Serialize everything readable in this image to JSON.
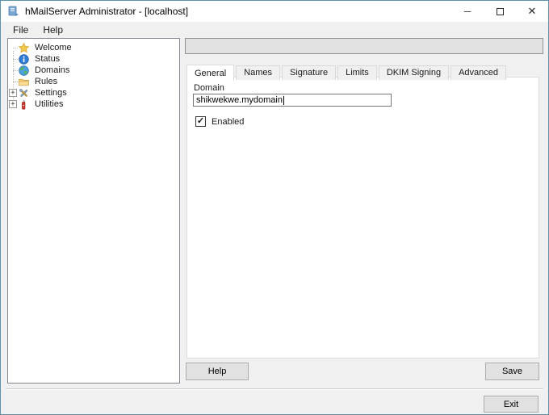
{
  "window": {
    "title": "hMailServer Administrator - [localhost]",
    "minimize_glyph": "─",
    "close_glyph": "✕"
  },
  "menu": {
    "file": "File",
    "help": "Help"
  },
  "sidebar": {
    "items": [
      {
        "label": "Welcome",
        "icon": "star-icon"
      },
      {
        "label": "Status",
        "icon": "info-icon"
      },
      {
        "label": "Domains",
        "icon": "globe-icon"
      },
      {
        "label": "Rules",
        "icon": "folder-icon"
      },
      {
        "label": "Settings",
        "icon": "tools-icon",
        "expand_glyph": "+"
      },
      {
        "label": "Utilities",
        "icon": "knife-icon",
        "expand_glyph": "+"
      }
    ]
  },
  "tabs": {
    "active": "General",
    "items": [
      {
        "label": "General"
      },
      {
        "label": "Names"
      },
      {
        "label": "Signature"
      },
      {
        "label": "Limits"
      },
      {
        "label": "DKIM Signing"
      },
      {
        "label": "Advanced"
      }
    ]
  },
  "form": {
    "domain_label": "Domain",
    "domain_value": "shikwekwe.mydomain",
    "enabled_label": "Enabled",
    "enabled_checked": true,
    "check_glyph": "✓"
  },
  "buttons": {
    "help": "Help",
    "save": "Save",
    "exit": "Exit"
  },
  "colors": {
    "window_background": "#f0f0f0",
    "panel_background": "#ffffff",
    "accent_border": "#5d93aa",
    "button_face": "#e1e1e1",
    "button_border": "#adadad",
    "gray_bar": "#e2e2e2"
  }
}
